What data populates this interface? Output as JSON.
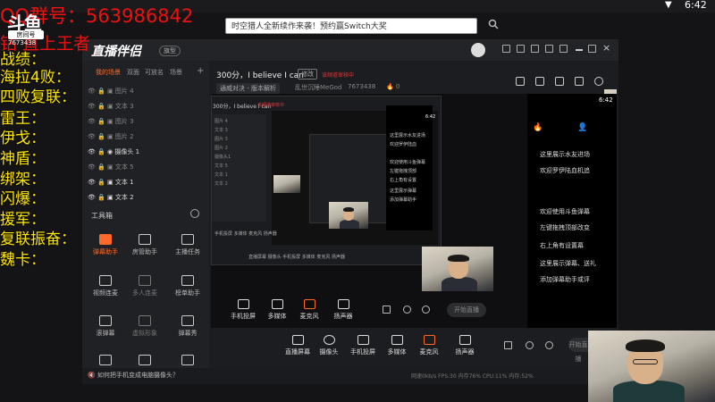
{
  "stream_overlay": {
    "qq_text": "QQ群号：563986842",
    "logo_main": "斗鱼",
    "logo_tag": "房间号",
    "logo_id": "7673438",
    "slogan_fragment": "钻    直上王者",
    "stats": [
      "战绩：",
      "海拉4败：",
      "四败复联：",
      "雷王：",
      "伊戈：",
      "神盾：",
      "绑架：",
      "闪爆：",
      "援军：",
      "复联振奋：",
      "魏卡："
    ],
    "search_text": "时空猎人全新续作来袭！预约赢Switch大奖",
    "clock": "6:42",
    "collapse_glyph": "▼"
  },
  "app": {
    "logo_text": "直播伴侣",
    "version_tag": "旗型",
    "scene_tabs": [
      "我的场景",
      "双面",
      "可放名",
      "场景",
      "+"
    ],
    "scene_items": [
      {
        "label": "图片 4",
        "on": false
      },
      {
        "label": "文本 3",
        "on": false
      },
      {
        "label": "图片 3",
        "on": false
      },
      {
        "label": "图片 2",
        "on": false
      },
      {
        "label": "摄像头 1",
        "on": true
      },
      {
        "label": "文本 5",
        "on": false
      },
      {
        "label": "文本 1",
        "on": true
      },
      {
        "label": "文本 2",
        "on": true
      }
    ],
    "tools_title": "工具箱",
    "tools": [
      "弹幕助手",
      "房管助手",
      "主播任务",
      "视频连麦",
      "多人连麦",
      "榜单助手",
      "滚弹幕",
      "虚拟形象",
      "弹幕秀"
    ],
    "room": {
      "title": "300分，I believe I can",
      "tag": "修改",
      "live_status": "该频道审核中",
      "category": "通威对决 - 版本解析",
      "owner": "乱世沉睡MeGod",
      "id": "7673438",
      "heat": "0"
    },
    "controls": [
      "直播屏幕",
      "摄像头",
      "手机投屏",
      "多媒体",
      "麦克风",
      "扬声器"
    ],
    "controls_partial": [
      "手机投屏",
      "多媒体",
      "麦克风",
      "扬声器"
    ],
    "start_button": "开始直播",
    "start_button_mid": "开始直播",
    "bottom_help": "如何把手机变成电脑摄像头？",
    "bottom_stats": "网速0kb/s    FPS:30    内存76%    CPU:11%    内存:52%"
  },
  "nested": {
    "title": "300分，I believe I can",
    "live": "该频道审核中",
    "mini_rows": [
      "图片 4",
      "文本 3",
      "图片 3",
      "图片 2",
      "摄像头1",
      "文本 5",
      "文本 1",
      "文本 2"
    ],
    "ctrl_row": "手机投屏  多媒体  麦克风  扬声器",
    "ctrl_row2": "直播屏幕  摄像头  手机投屏  多媒体  麦克风  扬声器",
    "clock": "6:42"
  },
  "chat": {
    "clock": "6:42",
    "lines": [
      "这里展示水友进场",
      "欢迎罗伊陆血机追",
      "欢迎使用斗鱼弹幕",
      "左键拖拽顶部改变",
      "右上角有设置幕",
      "这里展示弹幕、送礼",
      "添加弹幕助手或评"
    ],
    "small_lines": [
      "这里展示水友进场",
      "欢迎罗伊陆血",
      "欢迎使用斗鱼弹幕",
      "左键拖拽顶部",
      "右上角有设置",
      "这里展示弹幕",
      "添加弹幕助手"
    ]
  }
}
